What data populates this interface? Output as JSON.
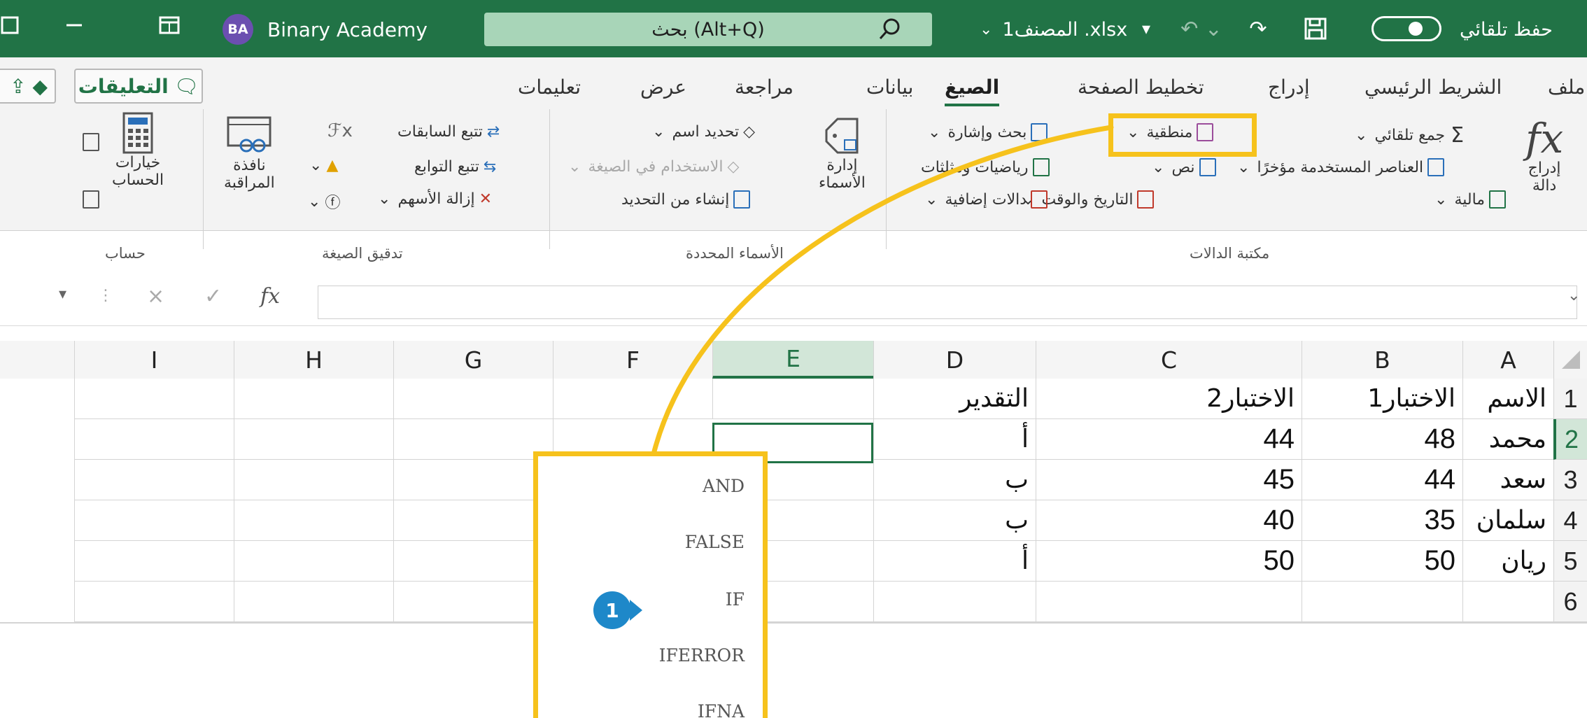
{
  "titlebar": {
    "autosave_label": "حفظ تلقائي",
    "filename": "المصنف1 .xlsx",
    "search_text": "بحث (Alt+Q)",
    "account_initials": "BA",
    "account_name": "Binary Academy",
    "color": "#217346"
  },
  "ribbon": {
    "tabs": [
      "ملف",
      "الشريط الرئيسي",
      "إدراج",
      "تخطيط الصفحة",
      "الصيغ",
      "بيانات",
      "مراجعة",
      "عرض",
      "تعليمات"
    ],
    "active_tab": "الصيغ",
    "comments_label": "التعليقات",
    "function_library": {
      "insert_function_line1": "إدراج",
      "insert_function_line2": "دالة",
      "autosum": "جمع تلقائي",
      "recent": "العناصر المستخدمة مؤخرًا",
      "financial": "مالية",
      "logical": "منطقية",
      "text": "نص",
      "date_time": "التاريخ والوقت",
      "lookup": "بحث وإشارة",
      "math": "رياضيات ومثلثات",
      "more": "دالات إضافية",
      "group_label": "مكتبة الدالات"
    },
    "defined_names": {
      "manager_line1": "إدارة",
      "manager_line2": "الأسماء",
      "define_name": "تحديد اسم",
      "use_in_formula": "الاستخدام في الصيغة",
      "create_from_selection": "إنشاء من التحديد",
      "group_label": "الأسماء المحددة"
    },
    "formula_auditing": {
      "trace_precedents": "تتبع السابقات",
      "trace_dependents": "تتبع التوابع",
      "remove_arrows": "إزالة الأسهم",
      "watch_line1": "نافذة",
      "watch_line2": "المراقبة",
      "group_label": "تدقيق الصيغة"
    },
    "calculation": {
      "options_line1": "خيارات",
      "options_line2": "الحساب",
      "group_label": "حساب"
    }
  },
  "formula_bar": {
    "fx": "fx",
    "cancel": "×",
    "enter": "✓"
  },
  "grid": {
    "columns": [
      "A",
      "B",
      "C",
      "D",
      "E",
      "F",
      "G",
      "H",
      "I"
    ],
    "selected_column": "E",
    "rows": [
      "1",
      "2",
      "3",
      "4",
      "5",
      "6"
    ],
    "selected_row": "2",
    "headers": [
      "الاسم",
      "الاختبار1",
      "الاختبار2",
      "التقدير"
    ],
    "data": [
      [
        "محمد",
        "48",
        "44",
        "أ"
      ],
      [
        "سعد",
        "44",
        "45",
        "ب"
      ],
      [
        "سلمان",
        "35",
        "40",
        "ب"
      ],
      [
        "ريان",
        "50",
        "50",
        "أ"
      ]
    ]
  },
  "dropdown": {
    "items": [
      "AND",
      "FALSE",
      "IF",
      "IFERROR",
      "IFNA"
    ],
    "callout_number": "1",
    "highlight_color": "#f6c21c",
    "callout_color": "#1e88c9"
  }
}
